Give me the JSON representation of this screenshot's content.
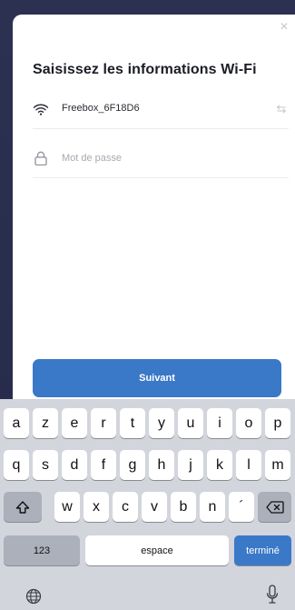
{
  "dialog": {
    "title": "Saisissez les informations Wi-Fi",
    "close_icon": "close-icon",
    "ssid": "Freebox_6F18D6",
    "ssid_icon": "wifi-icon",
    "swap_icon": "swap-icon",
    "password_placeholder": "Mot de passe",
    "password_icon": "lock-icon",
    "next_label": "Suivant",
    "accent_color": "#3a78c8"
  },
  "keyboard": {
    "row1": [
      "a",
      "z",
      "e",
      "r",
      "t",
      "y",
      "u",
      "i",
      "o",
      "p"
    ],
    "row2": [
      "q",
      "s",
      "d",
      "f",
      "g",
      "h",
      "j",
      "k",
      "l",
      "m"
    ],
    "row3": [
      "w",
      "x",
      "c",
      "v",
      "b",
      "n",
      "´"
    ],
    "shift_icon": "shift-icon",
    "backspace_icon": "backspace-icon",
    "numbers_label": "123",
    "space_label": "espace",
    "done_label": "terminé",
    "globe_icon": "globe-icon",
    "mic_icon": "mic-icon"
  }
}
